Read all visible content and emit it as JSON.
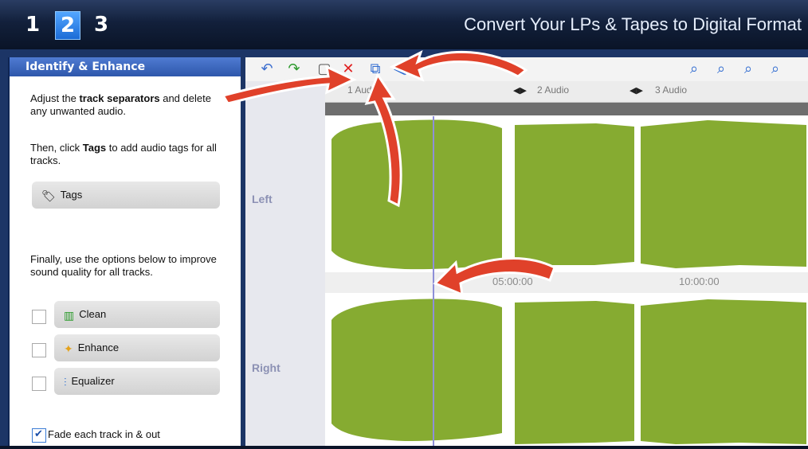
{
  "header": {
    "steps": [
      "1",
      "2",
      "3"
    ],
    "active_step": "2",
    "title": "Convert Your LPs & Tapes to Digital Format"
  },
  "panel": {
    "title": "Identify & Enhance",
    "intro_pre": "Adjust the ",
    "intro_bold": "track separators",
    "intro_post": " and delete any unwanted audio.",
    "tags_pre": "Then, click ",
    "tags_bold": "Tags",
    "tags_post": " to add audio tags for all tracks.",
    "tags_button": "Tags",
    "options_text": "Finally, use the options below to improve sound quality for all tracks.",
    "options": [
      {
        "label": "Clean",
        "icon": "clean-icon",
        "checked": false
      },
      {
        "label": "Enhance",
        "icon": "enhance-icon",
        "checked": false
      },
      {
        "label": "Equalizer",
        "icon": "equalizer-icon",
        "checked": false
      }
    ],
    "fade_label": "Fade each track in & out",
    "fade_checked": true
  },
  "editor": {
    "tracks": [
      "1 Audio",
      "2 Audio",
      "3 Audio"
    ],
    "channels": [
      "Left",
      "Right"
    ],
    "time_marks": [
      "05:00:00",
      "10:00:00"
    ]
  },
  "colors": {
    "waveform": "#86ab31",
    "arrow": "#e0412a",
    "cursor": "#8e8fd8"
  }
}
